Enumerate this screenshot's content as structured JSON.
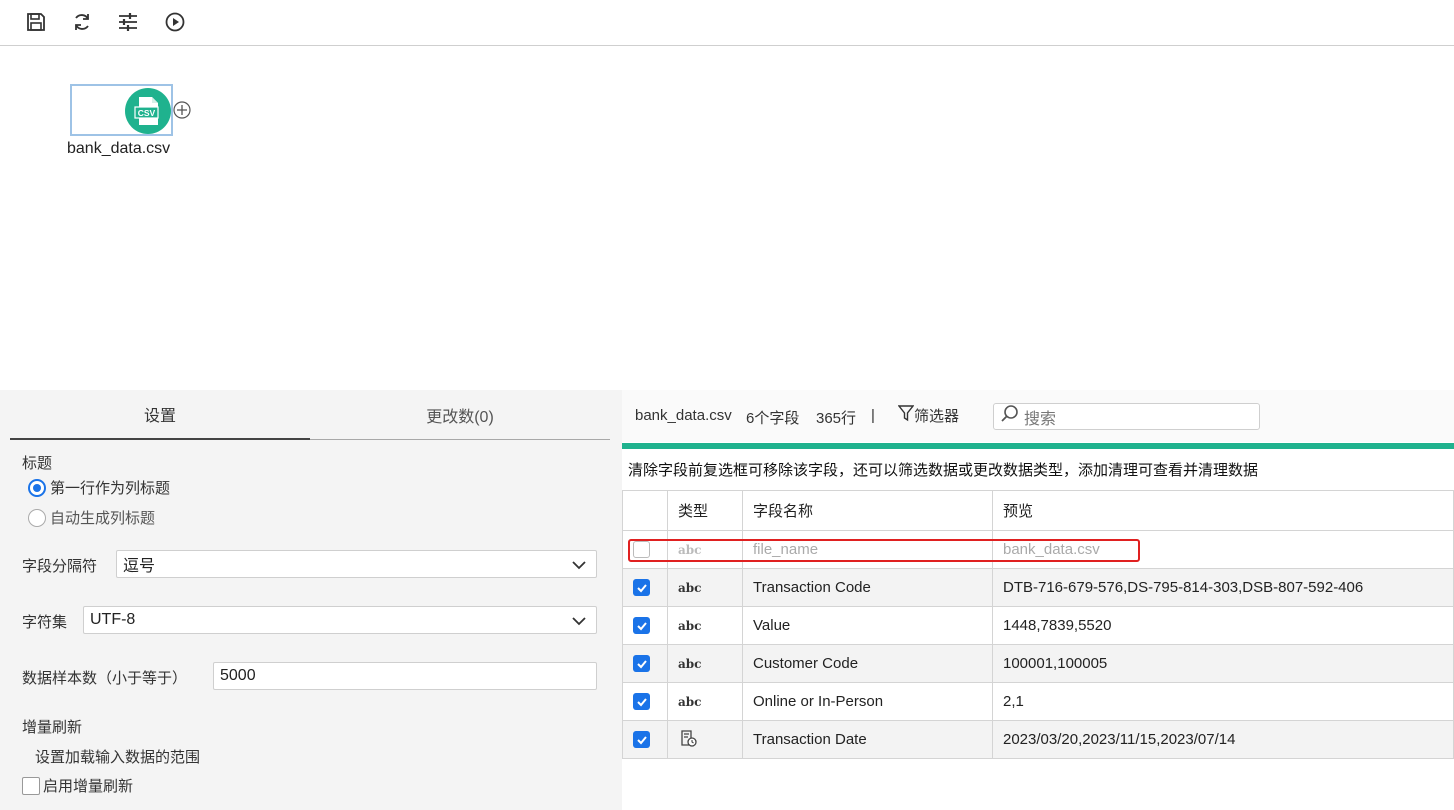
{
  "toolbar": {
    "save_icon": "save-icon",
    "refresh_icon": "refresh-icon",
    "settings_icon": "sliders-icon",
    "run_icon": "play-icon"
  },
  "canvas": {
    "node_label": "bank_data.csv",
    "node_icon": "csv-file-icon",
    "node_icon_text": "CSV",
    "accent": "#1fb28e"
  },
  "left": {
    "tabs": [
      {
        "label": "设置",
        "active": true
      },
      {
        "label": "更改数(0)",
        "active": false
      }
    ],
    "header_section": "标题",
    "radio_first_row": "第一行作为列标题",
    "radio_auto": "自动生成列标题",
    "delimiter_label": "字段分隔符",
    "delimiter_value": "逗号",
    "charset_label": "字符集",
    "charset_value": "UTF-8",
    "sample_label": "数据样本数（小于等于）",
    "sample_value": "5000",
    "incremental_section": "增量刷新",
    "incremental_desc": "设置加载输入数据的范围",
    "incremental_checkbox": "启用增量刷新"
  },
  "right": {
    "file_name": "bank_data.csv",
    "field_count": "6个字段",
    "row_count": "365行",
    "separator": "|",
    "filter_label": "筛选器",
    "search_placeholder": "搜索",
    "hint": "清除字段前复选框可移除该字段，还可以筛选数据或更改数据类型，添加清理可查看并清理数据",
    "columns": [
      "类型",
      "字段名称",
      "预览"
    ],
    "rows": [
      {
        "checked": false,
        "type": "abc",
        "name": "file_name",
        "preview": "bank_data.csv"
      },
      {
        "checked": true,
        "type": "abc",
        "name": "Transaction Code",
        "preview": "DTB-716-679-576,DS-795-814-303,DSB-807-592-406"
      },
      {
        "checked": true,
        "type": "abc",
        "name": "Value",
        "preview": "1448,7839,5520"
      },
      {
        "checked": true,
        "type": "abc",
        "name": "Customer Code",
        "preview": "100001,100005"
      },
      {
        "checked": true,
        "type": "abc",
        "name": "Online or In-Person",
        "preview": "2,1"
      },
      {
        "checked": true,
        "type": "date-icon",
        "name": "Transaction Date",
        "preview": "2023/03/20,2023/11/15,2023/07/14"
      }
    ]
  }
}
